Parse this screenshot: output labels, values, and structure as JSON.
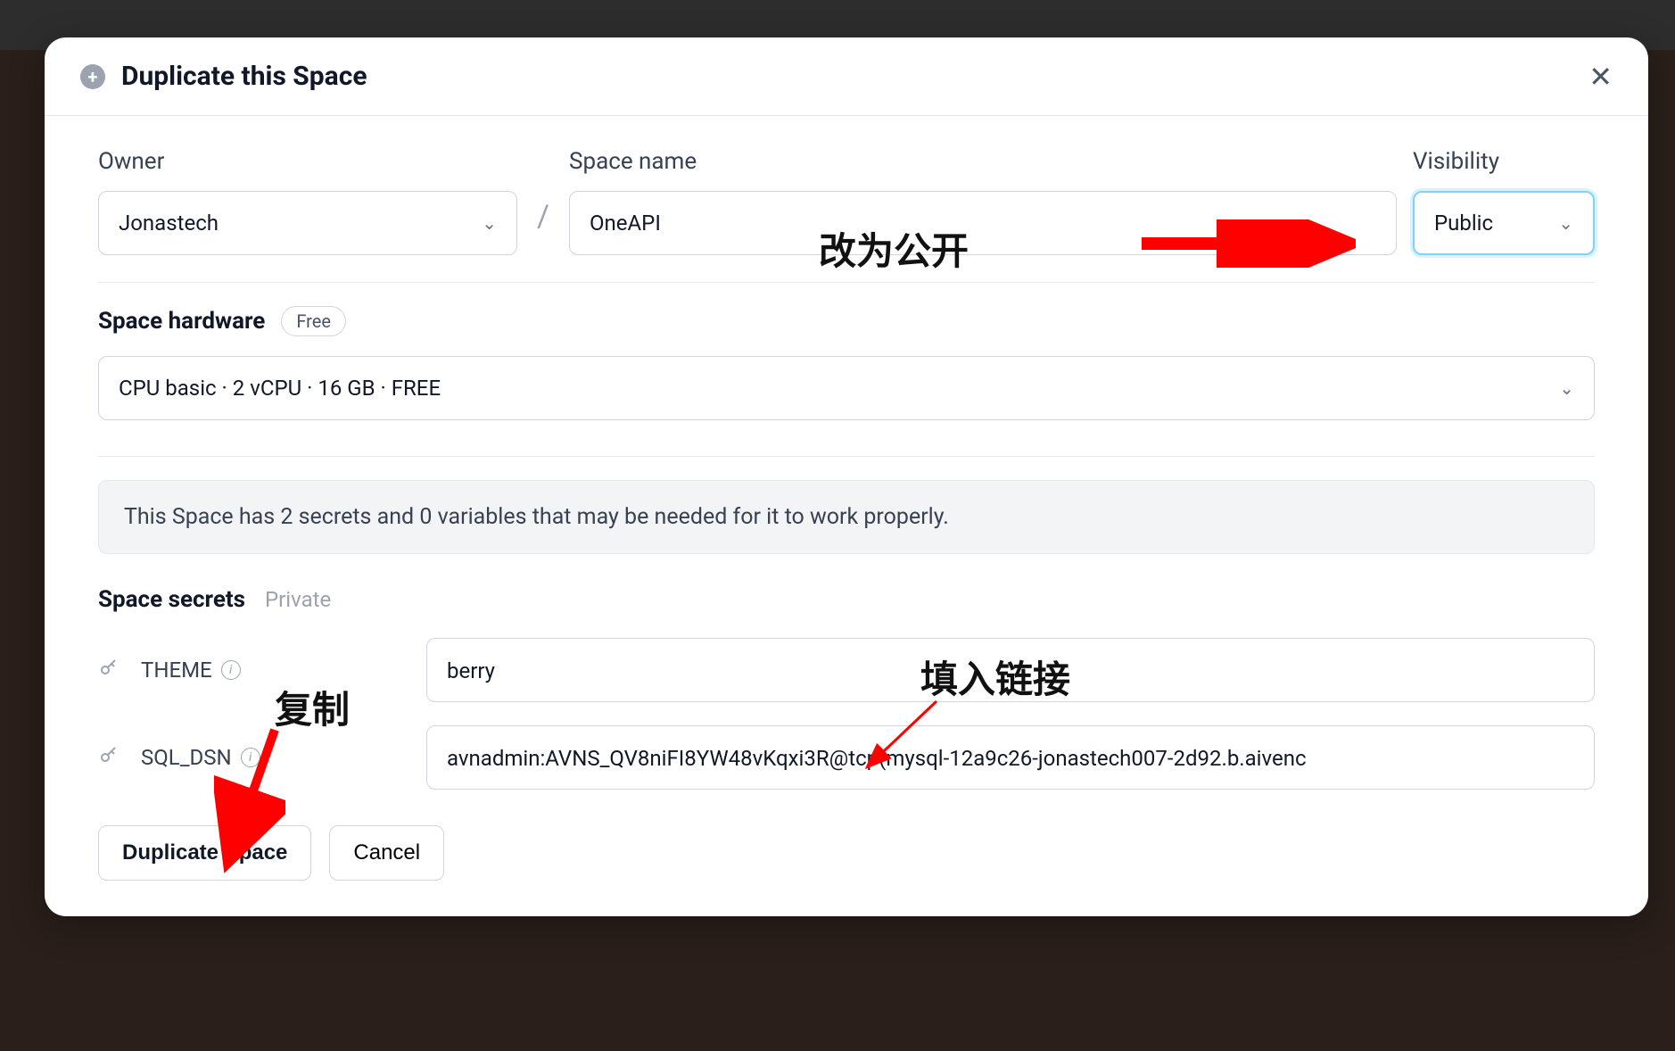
{
  "modal": {
    "title": "Duplicate this Space",
    "owner_label": "Owner",
    "owner_value": "Jonastech",
    "name_label": "Space name",
    "name_value": "OneAPI",
    "visibility_label": "Visibility",
    "visibility_value": "Public",
    "slash": "/"
  },
  "hardware": {
    "label": "Space hardware",
    "badge": "Free",
    "value": "CPU basic · 2 vCPU · 16 GB · FREE"
  },
  "info": {
    "text": "This Space has 2 secrets and 0 variables that may be needed for it to work properly."
  },
  "secrets": {
    "title": "Space secrets",
    "private": "Private",
    "items": [
      {
        "name": "THEME",
        "value": "berry",
        "has_info": true
      },
      {
        "name": "SQL_DSN",
        "value": "avnadmin:AVNS_QV8niFI8YW48vKqxi3R@tcp(mysql-12a9c26-jonastech007-2d92.b.aivenc",
        "has_info": true
      }
    ]
  },
  "buttons": {
    "duplicate": "Duplicate Space",
    "cancel": "Cancel"
  },
  "annotations": {
    "change_public": "改为公开",
    "copy": "复制",
    "fill_link": "填入链接"
  }
}
